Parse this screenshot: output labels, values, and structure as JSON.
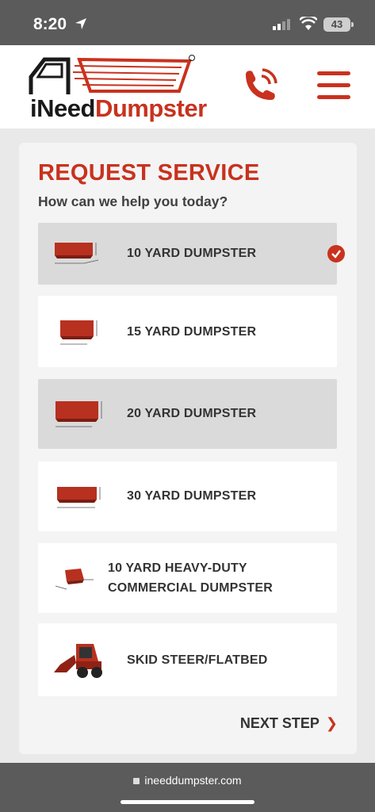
{
  "status": {
    "time": "8:20",
    "battery": "43"
  },
  "header": {
    "logo_prefix": "i",
    "logo_main": "Need",
    "logo_accent": "Dumpster"
  },
  "form": {
    "title": "REQUEST SERVICE",
    "subtitle": "How can we help you today?",
    "options": [
      {
        "label": "10 YARD DUMPSTER"
      },
      {
        "label": "15 YARD DUMPSTER"
      },
      {
        "label": "20 YARD DUMPSTER"
      },
      {
        "label": "30 YARD DUMPSTER"
      },
      {
        "label": "10 YARD HEAVY-DUTY COMMERCIAL DUMPSTER"
      },
      {
        "label": "SKID STEER/FLATBED"
      }
    ],
    "next_label": "NEXT STEP"
  },
  "browser": {
    "url": "ineeddumpster.com"
  },
  "colors": {
    "accent": "#c8321e",
    "status_bar": "#5b5b5b"
  }
}
